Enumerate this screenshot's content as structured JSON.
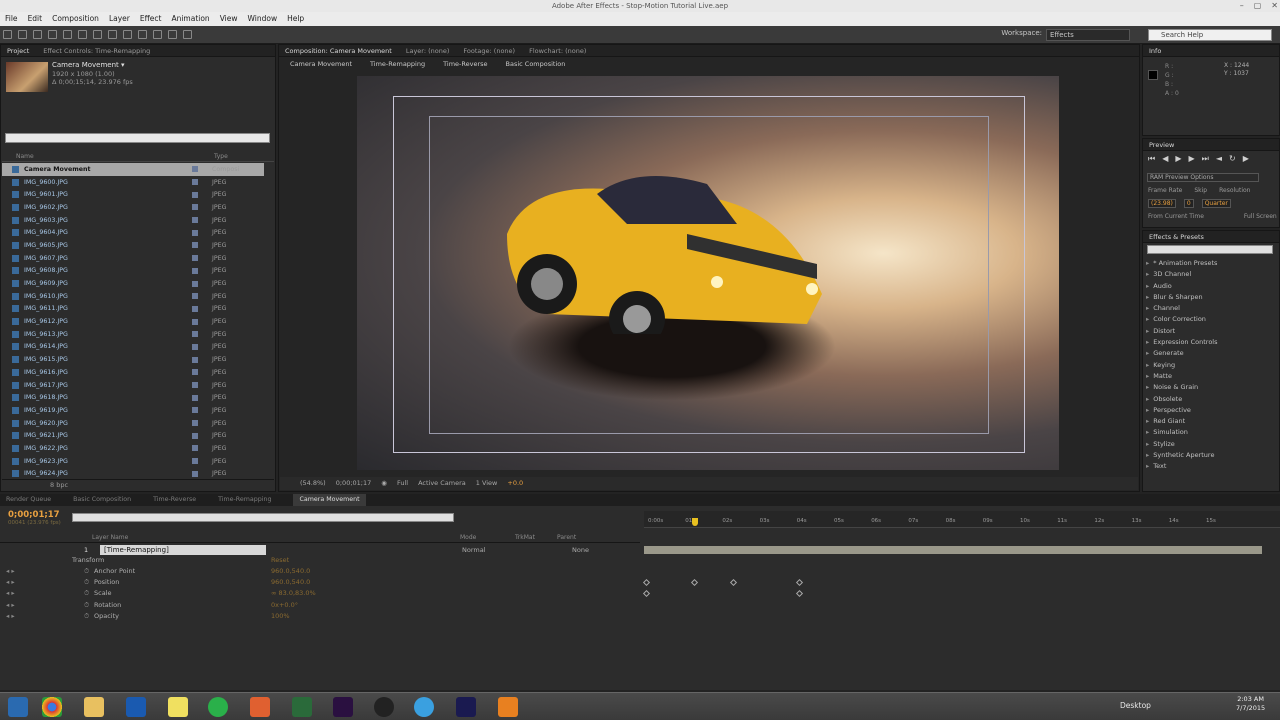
{
  "app": {
    "title": "Adobe After Effects - Stop-Motion Tutorial Live.aep"
  },
  "menu": [
    "File",
    "Edit",
    "Composition",
    "Layer",
    "Effect",
    "Animation",
    "View",
    "Window",
    "Help"
  ],
  "workspace": {
    "label": "Workspace:",
    "value": "Effects"
  },
  "search_help": {
    "placeholder": "Search Help"
  },
  "project": {
    "tabs": [
      "Project",
      "Effect Controls: Time-Remapping"
    ],
    "item_name": "Camera Movement ▾",
    "item_size": "1920 x 1080 (1.00)",
    "item_duration": "Δ 0;00;15;14, 23.976 fps",
    "col_name": "Name",
    "col_type": "Type",
    "rows": [
      {
        "name": "Camera Movement",
        "type": "Composi"
      },
      {
        "name": "IMG_9600.JPG",
        "type": "JPEG"
      },
      {
        "name": "IMG_9601.JPG",
        "type": "JPEG"
      },
      {
        "name": "IMG_9602.JPG",
        "type": "JPEG"
      },
      {
        "name": "IMG_9603.JPG",
        "type": "JPEG"
      },
      {
        "name": "IMG_9604.JPG",
        "type": "JPEG"
      },
      {
        "name": "IMG_9605.JPG",
        "type": "JPEG"
      },
      {
        "name": "IMG_9607.JPG",
        "type": "JPEG"
      },
      {
        "name": "IMG_9608.JPG",
        "type": "JPEG"
      },
      {
        "name": "IMG_9609.JPG",
        "type": "JPEG"
      },
      {
        "name": "IMG_9610.JPG",
        "type": "JPEG"
      },
      {
        "name": "IMG_9611.JPG",
        "type": "JPEG"
      },
      {
        "name": "IMG_9612.JPG",
        "type": "JPEG"
      },
      {
        "name": "IMG_9613.JPG",
        "type": "JPEG"
      },
      {
        "name": "IMG_9614.JPG",
        "type": "JPEG"
      },
      {
        "name": "IMG_9615.JPG",
        "type": "JPEG"
      },
      {
        "name": "IMG_9616.JPG",
        "type": "JPEG"
      },
      {
        "name": "IMG_9617.JPG",
        "type": "JPEG"
      },
      {
        "name": "IMG_9618.JPG",
        "type": "JPEG"
      },
      {
        "name": "IMG_9619.JPG",
        "type": "JPEG"
      },
      {
        "name": "IMG_9620.JPG",
        "type": "JPEG"
      },
      {
        "name": "IMG_9621.JPG",
        "type": "JPEG"
      },
      {
        "name": "IMG_9622.JPG",
        "type": "JPEG"
      },
      {
        "name": "IMG_9623.JPG",
        "type": "JPEG"
      },
      {
        "name": "IMG_9624.JPG",
        "type": "JPEG"
      }
    ],
    "footer": "8 bpc"
  },
  "composition": {
    "tabs": [
      "Composition: Camera Movement",
      "Layer: (none)",
      "Footage: (none)",
      "Flowchart: (none)"
    ],
    "breadcrumbs": [
      "Camera Movement",
      "Time-Remapping",
      "Time-Reverse",
      "Basic Composition"
    ],
    "zoom": "(54.8%)",
    "time": "0;00;01;17",
    "resolution": "Full",
    "view": "Active Camera",
    "views": "1 View",
    "exposure": "+0.0"
  },
  "info": {
    "title": "Info",
    "r": "R :",
    "g": "G :",
    "b": "B :",
    "a": "A : 0",
    "x": "X : 1244",
    "y": "Y : 1037"
  },
  "preview": {
    "title": "Preview",
    "ram_options": "RAM Preview Options",
    "frame_rate_label": "Frame Rate",
    "skip_label": "Skip",
    "resolution_label": "Resolution",
    "frame_rate": "(23.98)",
    "skip": "0",
    "resolution": "Quarter",
    "from_current": "From Current Time",
    "full_screen": "Full Screen"
  },
  "effects": {
    "title": "Effects & Presets",
    "items": [
      "* Animation Presets",
      "3D Channel",
      "Audio",
      "Blur & Sharpen",
      "Channel",
      "Color Correction",
      "Distort",
      "Expression Controls",
      "Generate",
      "Keying",
      "Matte",
      "Noise & Grain",
      "Obsolete",
      "Perspective",
      "Red Giant",
      "Simulation",
      "Stylize",
      "Synthetic Aperture",
      "Text"
    ]
  },
  "timeline": {
    "tabs": [
      "Render Queue",
      "Basic Composition",
      "Time-Reverse",
      "Time-Remapping",
      "Camera Movement"
    ],
    "timecode": "0;00;01;17",
    "timecode_sub": "00041 (23.976 fps)",
    "col_layer": "Layer Name",
    "col_mode": "Mode",
    "col_trkmat": "TrkMat",
    "col_parent": "Parent",
    "layer": {
      "num": "1",
      "name": "[Time-Remapping]",
      "mode": "Normal",
      "parent": "None"
    },
    "transform": "Transform",
    "reset": "Reset",
    "props": [
      {
        "name": "Anchor Point",
        "value": "960.0,540.0"
      },
      {
        "name": "Position",
        "value": "960.0,540.0"
      },
      {
        "name": "Scale",
        "value": "∞ 83.0,83.0%"
      },
      {
        "name": "Rotation",
        "value": "0x+0.0°"
      },
      {
        "name": "Opacity",
        "value": "100%"
      }
    ],
    "ticks": [
      "0:00s",
      "01s",
      "02s",
      "03s",
      "04s",
      "05s",
      "06s",
      "07s",
      "08s",
      "09s",
      "10s",
      "11s",
      "12s",
      "13s",
      "14s",
      "15s"
    ]
  },
  "taskbar": {
    "desktop": "Desktop",
    "time": "2:03 AM",
    "date": "7/7/2015"
  },
  "colors": {
    "accent": "#e8a040",
    "panel": "#2c2c2c",
    "selection": "#a8a8a8"
  }
}
